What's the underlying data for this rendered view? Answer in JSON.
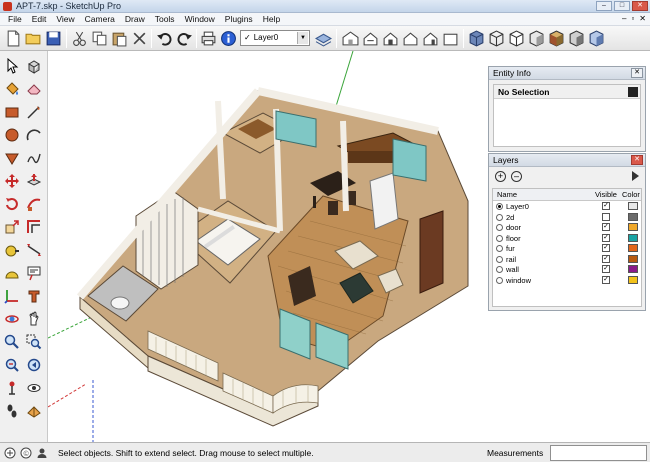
{
  "window": {
    "title": "APT-7.skp - SketchUp Pro",
    "minimize": "–",
    "maximize": "□",
    "close": "✕"
  },
  "menu": {
    "items": [
      "File",
      "Edit",
      "View",
      "Camera",
      "Draw",
      "Tools",
      "Window",
      "Plugins",
      "Help"
    ],
    "mdi": [
      "–",
      "▫",
      "✕"
    ]
  },
  "toolbar": {
    "layer_value": "Layer0",
    "layer_check": "✓",
    "icons": [
      "new-file-icon",
      "open-folder-icon",
      "save-icon",
      "cut-icon",
      "copy-icon",
      "paste-icon",
      "erase-icon",
      "undo-icon",
      "redo-icon",
      "print-icon",
      "model-info-icon",
      "layer-manager-icon",
      "iso-view-icon",
      "top-view-icon",
      "front-view-icon",
      "right-view-icon",
      "back-view-icon",
      "left-view-icon",
      "xray-icon",
      "wireframe-icon",
      "hidden-line-icon",
      "shaded-icon",
      "shaded-textures-icon",
      "monochrome-icon"
    ]
  },
  "palette": {
    "icons": [
      "select-icon",
      "make-component-icon",
      "paint-bucket-icon",
      "eraser-icon",
      "rectangle-icon",
      "line-icon",
      "circle-icon",
      "arc-icon",
      "polygon-icon",
      "freehand-icon",
      "move-icon",
      "push-pull-icon",
      "rotate-icon",
      "follow-me-icon",
      "scale-icon",
      "offset-icon",
      "tape-measure-icon",
      "dimension-icon",
      "protractor-icon",
      "text-icon",
      "axes-icon",
      "3d-text-icon",
      "orbit-icon",
      "pan-icon",
      "zoom-icon",
      "zoom-window-icon",
      "zoom-extents-icon",
      "previous-view-icon",
      "position-camera-icon",
      "look-around-icon",
      "walk-icon",
      "section-plane-icon"
    ]
  },
  "entity_info": {
    "title": "Entity Info",
    "selection": "No Selection"
  },
  "layers": {
    "title": "Layers",
    "add_icon": "+",
    "remove_icon": "–",
    "col_name": "Name",
    "col_visible": "Visible",
    "col_color": "Color",
    "checkmark": "✓",
    "rows": [
      {
        "name": "Layer0",
        "active": true,
        "visible": true,
        "color": "#e8e8e8"
      },
      {
        "name": "2d",
        "active": false,
        "visible": false,
        "color": "#6b6b6b"
      },
      {
        "name": "door",
        "active": false,
        "visible": true,
        "color": "#f0a82a"
      },
      {
        "name": "floor",
        "active": false,
        "visible": true,
        "color": "#1aa3a3"
      },
      {
        "name": "fur",
        "active": false,
        "visible": true,
        "color": "#e2661a"
      },
      {
        "name": "rail",
        "active": false,
        "visible": true,
        "color": "#b85a10"
      },
      {
        "name": "wall",
        "active": false,
        "visible": true,
        "color": "#8a1a8a"
      },
      {
        "name": "window",
        "active": false,
        "visible": true,
        "color": "#f2c21a"
      }
    ]
  },
  "status": {
    "text": "Select objects. Shift to extend select. Drag mouse to select multiple.",
    "measurements_label": "Measurements",
    "measurements_value": ""
  }
}
